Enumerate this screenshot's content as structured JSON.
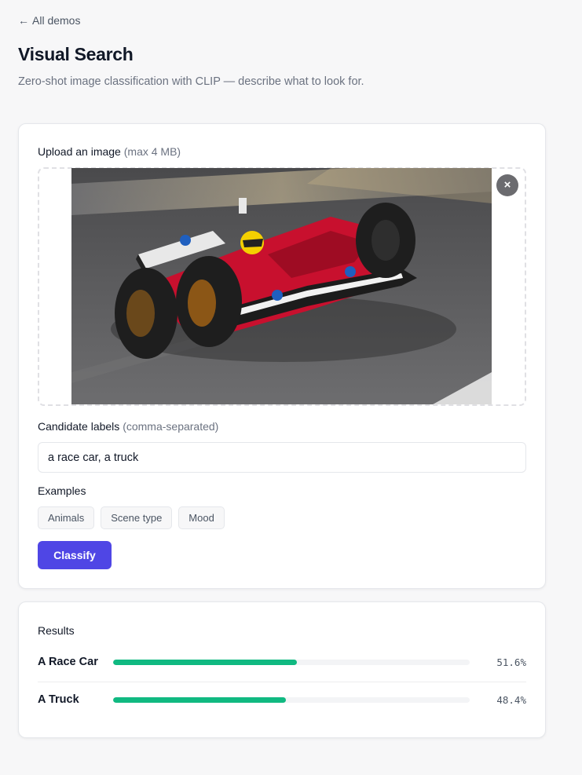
{
  "nav": {
    "back_arrow": "←",
    "back_label": "All demos"
  },
  "header": {
    "title": "Visual Search",
    "subtitle": "Zero-shot image classification with CLIP — describe what to look for."
  },
  "upload": {
    "label": "Upload an image",
    "hint": "(max 4 MB)",
    "remove_symbol": "×",
    "image_subject": "Red Formula 1 race car on track"
  },
  "labels": {
    "label": "Candidate labels",
    "hint": "(comma-separated)",
    "value": "a race car, a truck"
  },
  "examples": {
    "label": "Examples",
    "chips": [
      "Animals",
      "Scene type",
      "Mood"
    ]
  },
  "actions": {
    "classify_label": "Classify"
  },
  "results": {
    "title": "Results",
    "items": [
      {
        "name": "A Race Car",
        "pct_text": "51.6%",
        "value": 0.516
      },
      {
        "name": "A Truck",
        "pct_text": "48.4%",
        "value": 0.484
      }
    ]
  },
  "colors": {
    "accent": "#4f46e5",
    "bar": "#10b981",
    "car_red": "#c8102e"
  }
}
